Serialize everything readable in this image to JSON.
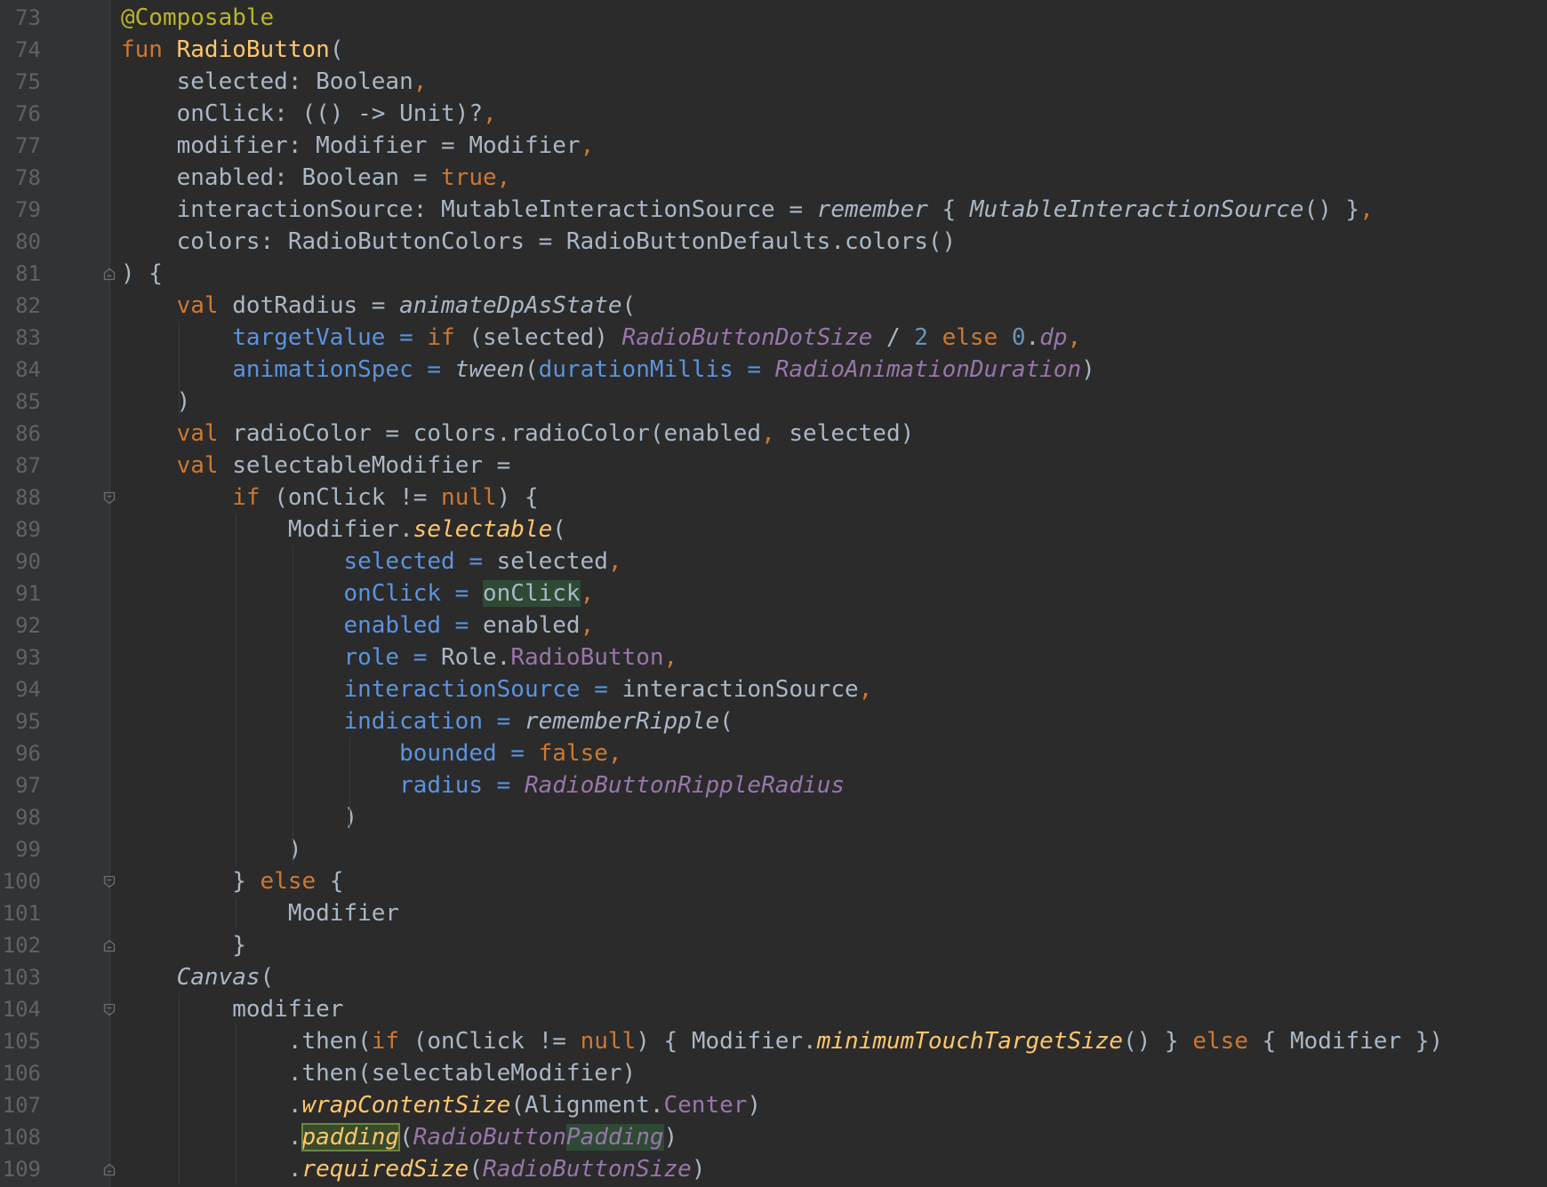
{
  "editor": {
    "language": "kotlin",
    "colors": {
      "background": "#2b2b2b",
      "gutter": "#313335",
      "line_number": "#606366",
      "keyword": "#cc7832",
      "function": "#ffc66d",
      "annotation": "#bbb529",
      "default": "#a9b7c6",
      "constant": "#9876aa",
      "named_argument": "#5b93e0",
      "number": "#6897bb"
    },
    "lines": [
      {
        "n": "73",
        "fold": null,
        "tokens": [
          {
            "t": "@Composable",
            "c": "ann"
          }
        ]
      },
      {
        "n": "74",
        "fold": null,
        "tokens": [
          {
            "t": "fun ",
            "c": "kw"
          },
          {
            "t": "RadioButton",
            "c": "fn"
          },
          {
            "t": "(",
            "c": "def"
          }
        ]
      },
      {
        "n": "75",
        "fold": null,
        "tokens": [
          {
            "t": "    selected: Boolean",
            "c": "def"
          },
          {
            "t": ",",
            "c": "kw"
          }
        ]
      },
      {
        "n": "76",
        "fold": null,
        "tokens": [
          {
            "t": "    onClick: (() -> Unit)?",
            "c": "def"
          },
          {
            "t": ",",
            "c": "kw"
          }
        ]
      },
      {
        "n": "77",
        "fold": null,
        "tokens": [
          {
            "t": "    modifier: Modifier = Modifier",
            "c": "def"
          },
          {
            "t": ",",
            "c": "kw"
          }
        ]
      },
      {
        "n": "78",
        "fold": null,
        "tokens": [
          {
            "t": "    enabled: Boolean = ",
            "c": "def"
          },
          {
            "t": "true",
            "c": "kw"
          },
          {
            "t": ",",
            "c": "kw"
          }
        ]
      },
      {
        "n": "79",
        "fold": null,
        "tokens": [
          {
            "t": "    interactionSource: MutableInteractionSource = ",
            "c": "def"
          },
          {
            "t": "remember",
            "c": "id"
          },
          {
            "t": " { ",
            "c": "def"
          },
          {
            "t": "MutableInteractionSource",
            "c": "id"
          },
          {
            "t": "() }",
            "c": "def"
          },
          {
            "t": ",",
            "c": "kw"
          }
        ]
      },
      {
        "n": "80",
        "fold": null,
        "tokens": [
          {
            "t": "    colors: RadioButtonColors = RadioButtonDefaults.colors()",
            "c": "def"
          }
        ]
      },
      {
        "n": "81",
        "fold": "end",
        "tokens": [
          {
            "t": ") {",
            "c": "def"
          }
        ]
      },
      {
        "n": "82",
        "fold": null,
        "tokens": [
          {
            "t": "    ",
            "c": "def"
          },
          {
            "t": "val ",
            "c": "kw"
          },
          {
            "t": "dotRadius = ",
            "c": "def"
          },
          {
            "t": "animateDpAsState",
            "c": "id"
          },
          {
            "t": "(",
            "c": "def"
          }
        ]
      },
      {
        "n": "83",
        "fold": null,
        "tokens": [
          {
            "t": "        ",
            "c": "def"
          },
          {
            "t": "targetValue = ",
            "c": "prm"
          },
          {
            "t": "if ",
            "c": "kw"
          },
          {
            "t": "(selected) ",
            "c": "def"
          },
          {
            "t": "RadioButtonDotSize",
            "c": "con"
          },
          {
            "t": " / ",
            "c": "def"
          },
          {
            "t": "2 ",
            "c": "num"
          },
          {
            "t": "else ",
            "c": "kw"
          },
          {
            "t": "0",
            "c": "num"
          },
          {
            "t": ".",
            "c": "def"
          },
          {
            "t": "dp",
            "c": "con"
          },
          {
            "t": ",",
            "c": "kw"
          }
        ]
      },
      {
        "n": "84",
        "fold": null,
        "tokens": [
          {
            "t": "        ",
            "c": "def"
          },
          {
            "t": "animationSpec = ",
            "c": "prm"
          },
          {
            "t": "tween",
            "c": "id"
          },
          {
            "t": "(",
            "c": "def"
          },
          {
            "t": "durationMillis = ",
            "c": "prm"
          },
          {
            "t": "RadioAnimationDuration",
            "c": "con"
          },
          {
            "t": ")",
            "c": "def"
          }
        ]
      },
      {
        "n": "85",
        "fold": null,
        "tokens": [
          {
            "t": "    )",
            "c": "def"
          }
        ]
      },
      {
        "n": "86",
        "fold": null,
        "tokens": [
          {
            "t": "    ",
            "c": "def"
          },
          {
            "t": "val ",
            "c": "kw"
          },
          {
            "t": "radioColor = colors.radioColor(enabled",
            "c": "def"
          },
          {
            "t": ",",
            "c": "kw"
          },
          {
            "t": " selected)",
            "c": "def"
          }
        ]
      },
      {
        "n": "87",
        "fold": null,
        "tokens": [
          {
            "t": "    ",
            "c": "def"
          },
          {
            "t": "val ",
            "c": "kw"
          },
          {
            "t": "selectableModifier =",
            "c": "def"
          }
        ]
      },
      {
        "n": "88",
        "fold": "start",
        "tokens": [
          {
            "t": "        ",
            "c": "def"
          },
          {
            "t": "if ",
            "c": "kw"
          },
          {
            "t": "(onClick != ",
            "c": "def"
          },
          {
            "t": "null",
            "c": "kw"
          },
          {
            "t": ") {",
            "c": "def"
          }
        ]
      },
      {
        "n": "89",
        "fold": null,
        "tokens": [
          {
            "t": "            Modifier.",
            "c": "def"
          },
          {
            "t": "selectable",
            "c": "ext"
          },
          {
            "t": "(",
            "c": "def"
          }
        ]
      },
      {
        "n": "90",
        "fold": null,
        "tokens": [
          {
            "t": "                ",
            "c": "def"
          },
          {
            "t": "selected = ",
            "c": "prm"
          },
          {
            "t": "selected",
            "c": "def"
          },
          {
            "t": ",",
            "c": "kw"
          }
        ]
      },
      {
        "n": "91",
        "fold": null,
        "tokens": [
          {
            "t": "                ",
            "c": "def"
          },
          {
            "t": "onClick = ",
            "c": "prm"
          },
          {
            "t": "onClick",
            "c": "def",
            "hl": "green"
          },
          {
            "t": ",",
            "c": "kw"
          }
        ]
      },
      {
        "n": "92",
        "fold": null,
        "tokens": [
          {
            "t": "                ",
            "c": "def"
          },
          {
            "t": "enabled = ",
            "c": "prm"
          },
          {
            "t": "enabled",
            "c": "def"
          },
          {
            "t": ",",
            "c": "kw"
          }
        ]
      },
      {
        "n": "93",
        "fold": null,
        "tokens": [
          {
            "t": "                ",
            "c": "def"
          },
          {
            "t": "role = ",
            "c": "prm"
          },
          {
            "t": "Role.",
            "c": "def"
          },
          {
            "t": "RadioButton",
            "c": "prop"
          },
          {
            "t": ",",
            "c": "kw"
          }
        ]
      },
      {
        "n": "94",
        "fold": null,
        "tokens": [
          {
            "t": "                ",
            "c": "def"
          },
          {
            "t": "interactionSource = ",
            "c": "prm"
          },
          {
            "t": "interactionSource",
            "c": "def"
          },
          {
            "t": ",",
            "c": "kw"
          }
        ]
      },
      {
        "n": "95",
        "fold": null,
        "tokens": [
          {
            "t": "                ",
            "c": "def"
          },
          {
            "t": "indication = ",
            "c": "prm"
          },
          {
            "t": "rememberRipple",
            "c": "id"
          },
          {
            "t": "(",
            "c": "def"
          }
        ]
      },
      {
        "n": "96",
        "fold": null,
        "tokens": [
          {
            "t": "                    ",
            "c": "def"
          },
          {
            "t": "bounded = ",
            "c": "prm"
          },
          {
            "t": "false",
            "c": "kw"
          },
          {
            "t": ",",
            "c": "kw"
          }
        ]
      },
      {
        "n": "97",
        "fold": null,
        "tokens": [
          {
            "t": "                    ",
            "c": "def"
          },
          {
            "t": "radius = ",
            "c": "prm"
          },
          {
            "t": "RadioButtonRippleRadius",
            "c": "con"
          }
        ]
      },
      {
        "n": "98",
        "fold": null,
        "tokens": [
          {
            "t": "                )",
            "c": "def"
          }
        ]
      },
      {
        "n": "99",
        "fold": null,
        "tokens": [
          {
            "t": "            )",
            "c": "def"
          }
        ]
      },
      {
        "n": "100",
        "fold": "start",
        "tokens": [
          {
            "t": "        } ",
            "c": "def"
          },
          {
            "t": "else ",
            "c": "kw"
          },
          {
            "t": "{",
            "c": "def"
          }
        ]
      },
      {
        "n": "101",
        "fold": null,
        "tokens": [
          {
            "t": "            Modifier",
            "c": "def"
          }
        ]
      },
      {
        "n": "102",
        "fold": "end",
        "tokens": [
          {
            "t": "        }",
            "c": "def"
          }
        ]
      },
      {
        "n": "103",
        "fold": null,
        "tokens": [
          {
            "t": "    ",
            "c": "def"
          },
          {
            "t": "Canvas",
            "c": "id"
          },
          {
            "t": "(",
            "c": "def"
          }
        ]
      },
      {
        "n": "104",
        "fold": "start",
        "tokens": [
          {
            "t": "        modifier",
            "c": "def"
          }
        ]
      },
      {
        "n": "105",
        "fold": null,
        "tokens": [
          {
            "t": "            .then(",
            "c": "def"
          },
          {
            "t": "if ",
            "c": "kw"
          },
          {
            "t": "(onClick != ",
            "c": "def"
          },
          {
            "t": "null",
            "c": "kw"
          },
          {
            "t": ") { Modifier.",
            "c": "def"
          },
          {
            "t": "minimumTouchTargetSize",
            "c": "ext"
          },
          {
            "t": "() } ",
            "c": "def"
          },
          {
            "t": "else ",
            "c": "kw"
          },
          {
            "t": "{ Modifier })",
            "c": "def"
          }
        ]
      },
      {
        "n": "106",
        "fold": null,
        "tokens": [
          {
            "t": "            .then(selectableModifier)",
            "c": "def"
          }
        ]
      },
      {
        "n": "107",
        "fold": null,
        "tokens": [
          {
            "t": "            .",
            "c": "def"
          },
          {
            "t": "wrapContentSize",
            "c": "ext"
          },
          {
            "t": "(Alignment.",
            "c": "def"
          },
          {
            "t": "Center",
            "c": "prop"
          },
          {
            "t": ")",
            "c": "def"
          }
        ]
      },
      {
        "n": "108",
        "fold": null,
        "tokens": [
          {
            "t": "            .",
            "c": "def"
          },
          {
            "t": "padding",
            "c": "ext",
            "hl": "box"
          },
          {
            "t": "(",
            "c": "def"
          },
          {
            "t": "RadioButton",
            "c": "con"
          },
          {
            "t": "Padding",
            "c": "con",
            "hl": "green"
          },
          {
            "t": ")",
            "c": "def"
          }
        ]
      },
      {
        "n": "109",
        "fold": "end",
        "tokens": [
          {
            "t": "            .",
            "c": "def"
          },
          {
            "t": "requiredSize",
            "c": "ext"
          },
          {
            "t": "(",
            "c": "def"
          },
          {
            "t": "RadioButtonSize",
            "c": "con"
          },
          {
            "t": ")",
            "c": "def"
          }
        ]
      }
    ]
  }
}
